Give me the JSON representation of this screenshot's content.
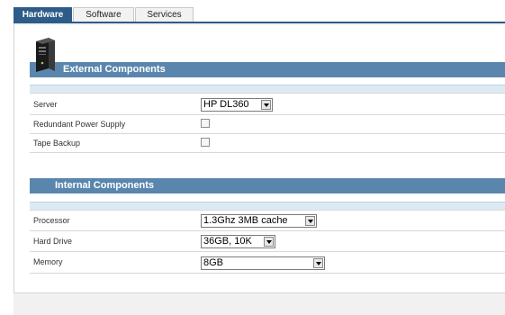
{
  "tabs": [
    {
      "label": "Hardware",
      "active": true
    },
    {
      "label": "Software",
      "active": false
    },
    {
      "label": "Services",
      "active": false
    }
  ],
  "external": {
    "title": "External Components",
    "icon": "server-tower-icon",
    "rows": [
      {
        "label": "Server",
        "control": "select",
        "value": "HP DL360"
      },
      {
        "label": "Redundant Power Supply",
        "control": "checkbox",
        "checked": false
      },
      {
        "label": "Tape Backup",
        "control": "checkbox",
        "checked": false
      }
    ]
  },
  "internal": {
    "title": "Internal Components",
    "rows": [
      {
        "label": "Processor",
        "control": "select",
        "value": "1.3Ghz 3MB cache"
      },
      {
        "label": "Hard Drive",
        "control": "select",
        "value": "36GB, 10K"
      },
      {
        "label": "Memory",
        "control": "select",
        "value": "8GB"
      }
    ]
  },
  "colors": {
    "tab_active": "#2d5c88",
    "section_header": "#5a86ae",
    "light_bar": "#dcebf3"
  }
}
